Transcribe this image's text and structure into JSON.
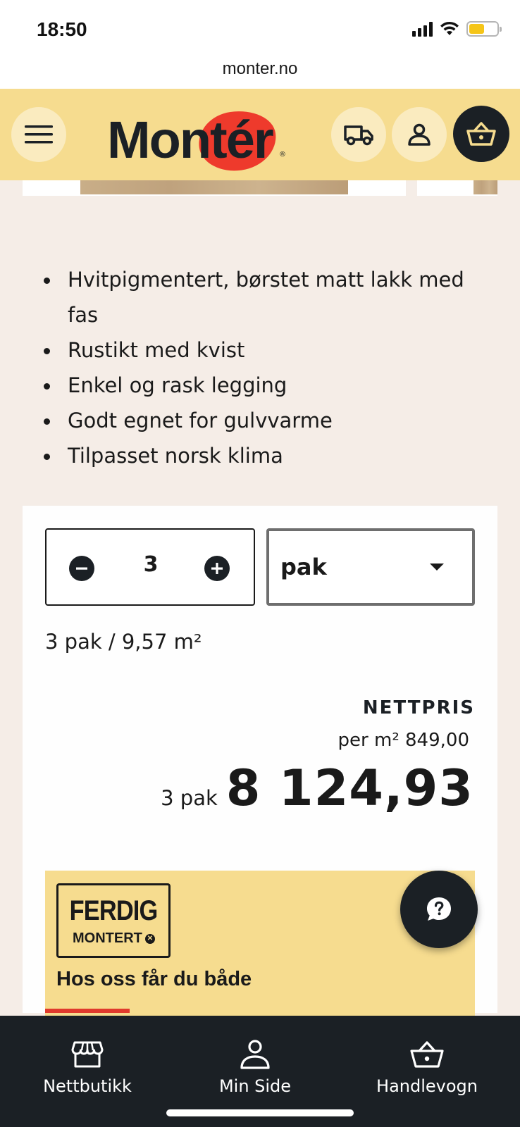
{
  "status_bar": {
    "time": "18:50"
  },
  "browser": {
    "url": "monter.no"
  },
  "header": {
    "logo_text": "Montér",
    "logo_registered": "®"
  },
  "features": [
    "Hvitpigmentert, børstet matt lakk med fas",
    "Rustikt med kvist",
    "Enkel og rask legging",
    "Godt egnet for gulvvarme",
    "Tilpasset norsk klima"
  ],
  "purchase": {
    "quantity": "3",
    "unit": "pak",
    "summary": "3 pak / 9,57 m²",
    "price_label": "NETTPRIS",
    "unit_price": "per m² 849,00",
    "total_qty": "3 pak",
    "total_price": "8 124,93"
  },
  "promo": {
    "badge_line1": "FERDIG",
    "badge_line2": "MONTERT",
    "heading": "Hos oss får du både"
  },
  "bottom_nav": {
    "items": [
      {
        "label": "Nettbutikk",
        "icon": "store-icon"
      },
      {
        "label": "Min Side",
        "icon": "user-icon"
      },
      {
        "label": "Handlevogn",
        "icon": "basket-icon"
      }
    ]
  },
  "colors": {
    "header_bg": "#f6dc8f",
    "page_bg": "#f5ede7",
    "dark": "#1b2025",
    "logo_red": "#ee3a2c"
  }
}
